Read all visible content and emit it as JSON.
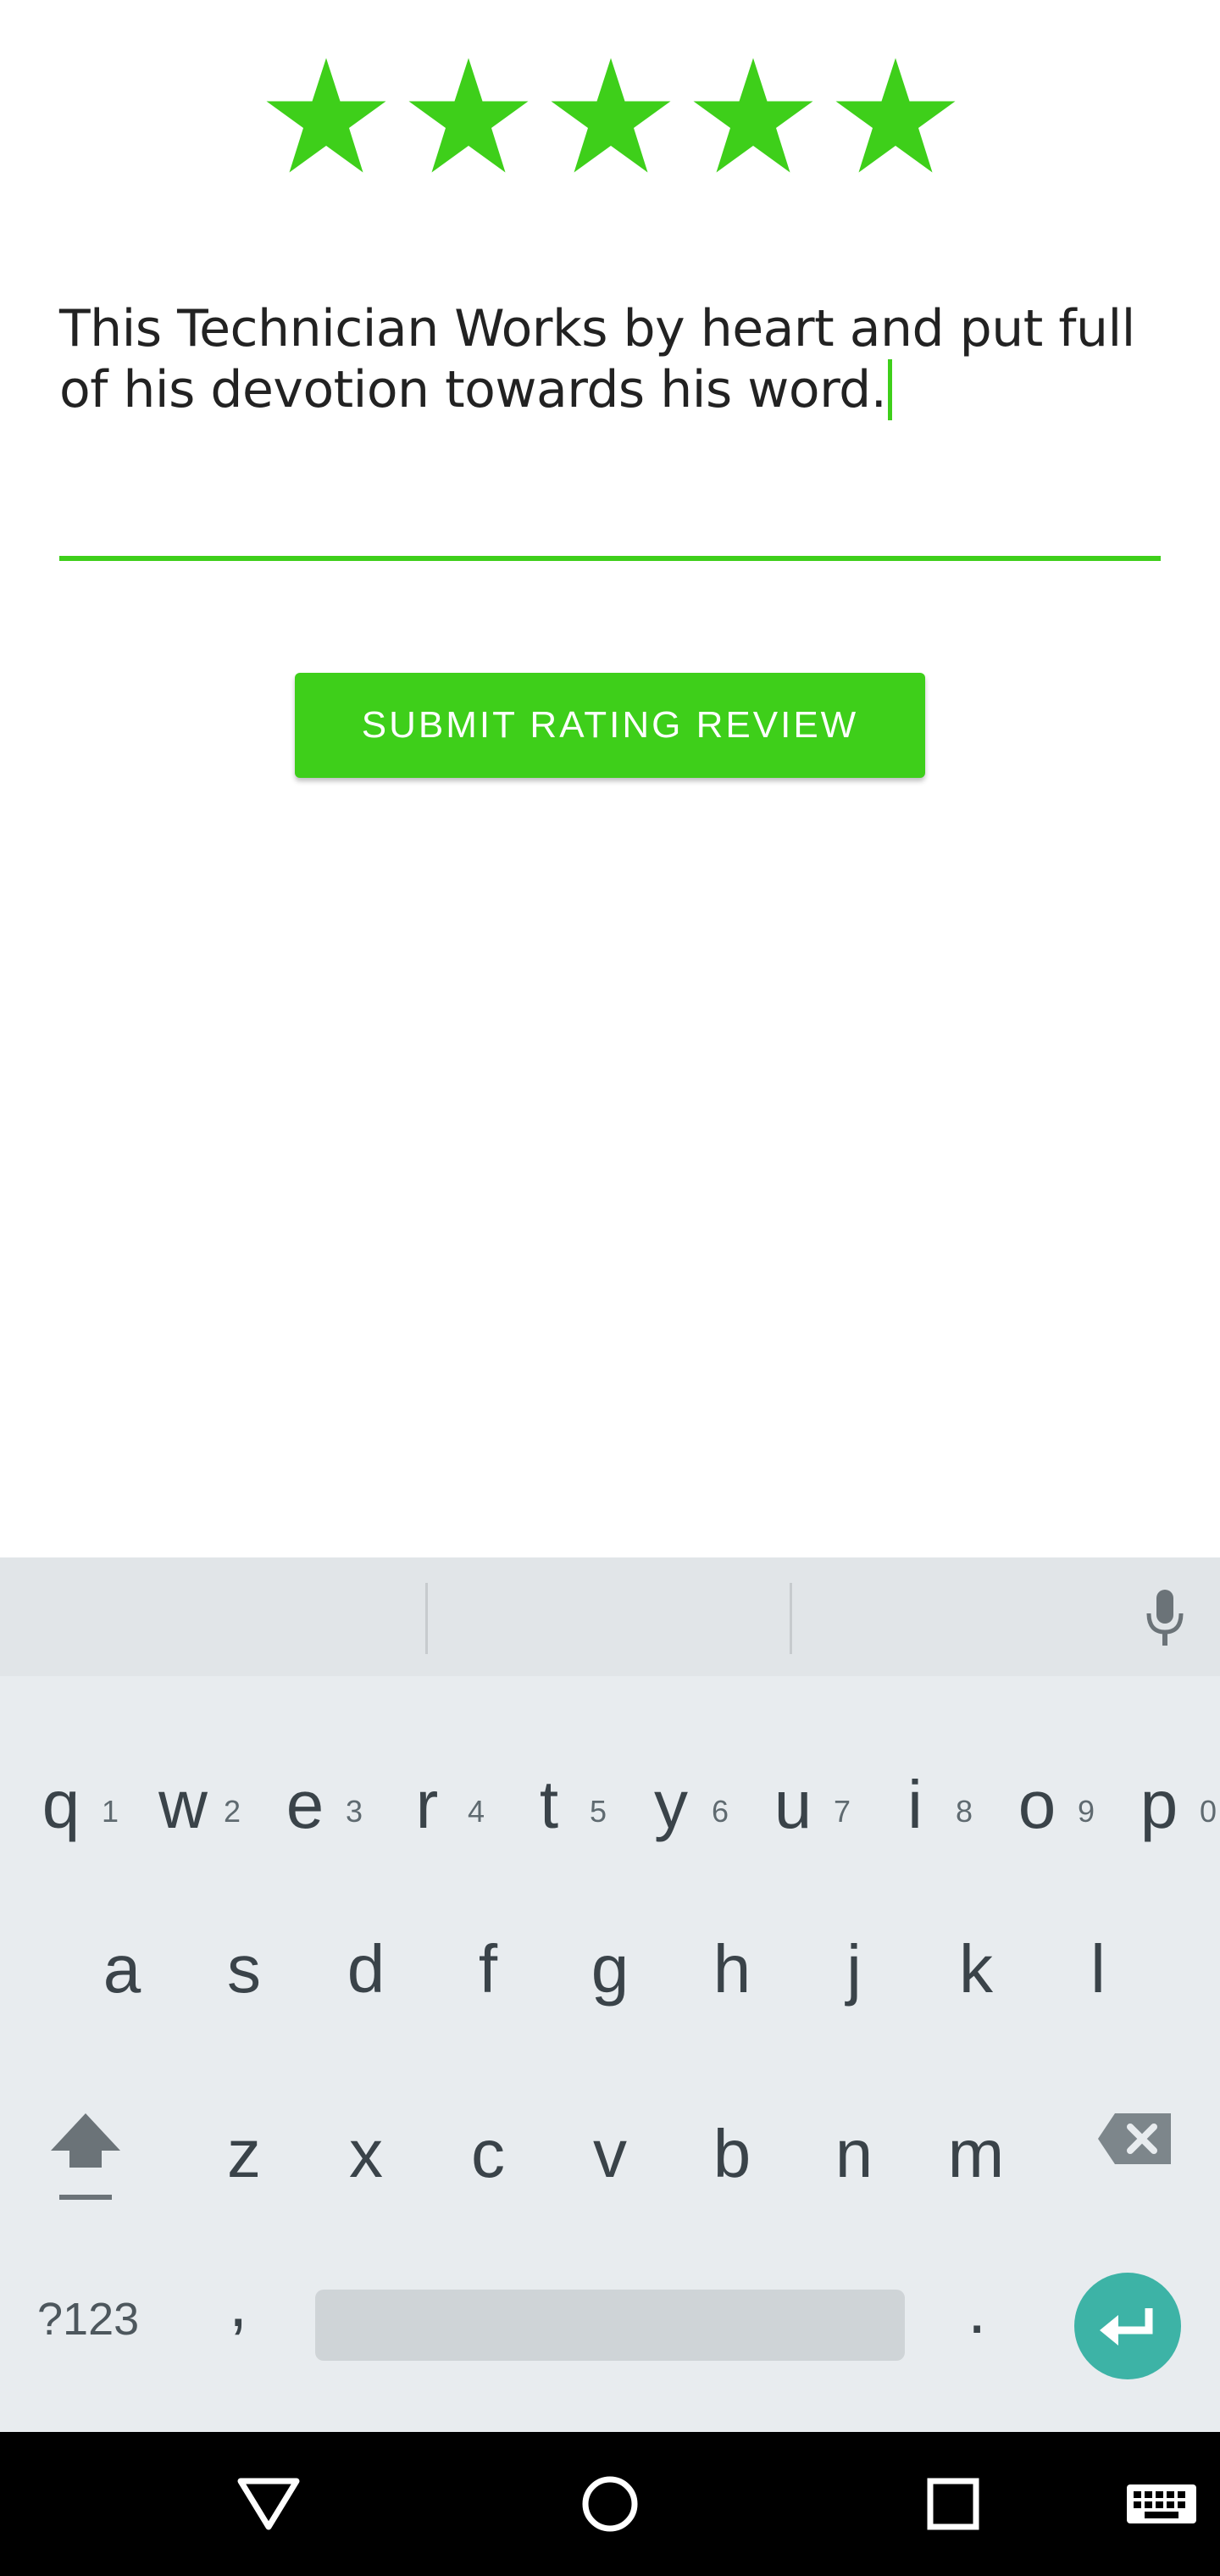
{
  "rating": {
    "value": 5,
    "max": 5,
    "star_color": "#3ecf1a",
    "stars": [
      "star-1",
      "star-2",
      "star-3",
      "star-4",
      "star-5"
    ]
  },
  "review": {
    "text": "This Technician Works by heart and put full of his devotion towards his word.",
    "accent_color": "#3ecf1a"
  },
  "submit_button": {
    "label": "SUBMIT RATING REVIEW"
  },
  "keyboard": {
    "row1": [
      {
        "key": "q",
        "hint": "1"
      },
      {
        "key": "w",
        "hint": "2"
      },
      {
        "key": "e",
        "hint": "3"
      },
      {
        "key": "r",
        "hint": "4"
      },
      {
        "key": "t",
        "hint": "5"
      },
      {
        "key": "y",
        "hint": "6"
      },
      {
        "key": "u",
        "hint": "7"
      },
      {
        "key": "i",
        "hint": "8"
      },
      {
        "key": "o",
        "hint": "9"
      },
      {
        "key": "p",
        "hint": "0"
      }
    ],
    "row2": [
      "a",
      "s",
      "d",
      "f",
      "g",
      "h",
      "j",
      "k",
      "l"
    ],
    "row3": [
      "z",
      "x",
      "c",
      "v",
      "b",
      "n",
      "m"
    ],
    "symbols_label": "?123",
    "comma_label": ",",
    "period_label": ".",
    "icons": [
      "shift-icon",
      "backspace-icon",
      "mic-icon",
      "enter-icon"
    ]
  },
  "navigation": {
    "icons": [
      "back-icon",
      "home-icon",
      "recents-icon",
      "keyboard-switch-icon"
    ]
  }
}
